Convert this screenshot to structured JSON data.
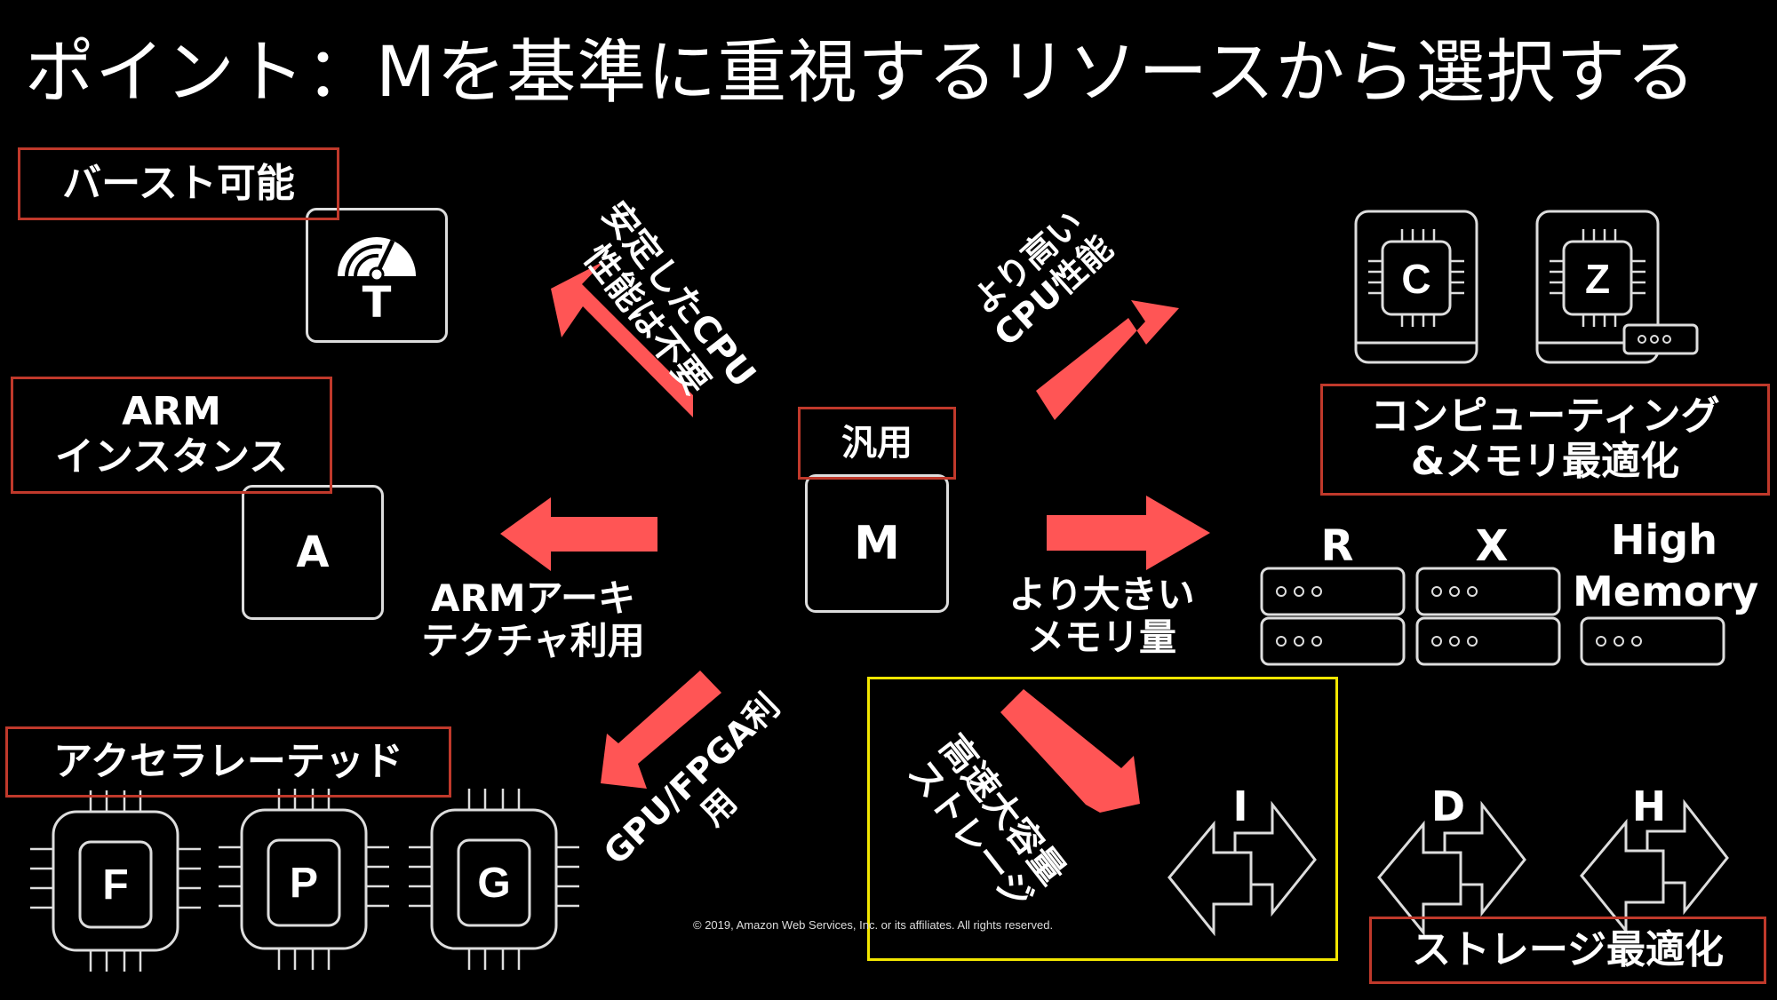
{
  "title": "ポイント：Mを基準に重視するリソースから選択する",
  "colors": {
    "background": "#000000",
    "arrow": "#ff5555",
    "label_border": "#c0392b",
    "highlight_border": "#f2e600",
    "icon_stroke": "#dddddd"
  },
  "center": {
    "label": "汎用",
    "instance": "M"
  },
  "groups": {
    "burst": {
      "label": "バースト可能",
      "instance": "T",
      "icon": "speedometer-icon"
    },
    "arm": {
      "label_line1": "ARM",
      "label_line2": "インスタンス",
      "instance": "A"
    },
    "accelerated": {
      "label": "アクセラレーテッド",
      "instances": [
        "F",
        "P",
        "G"
      ],
      "icon": "chip-icon"
    },
    "compute": {
      "instances": [
        "C",
        "Z"
      ],
      "icon": "chip-server-icon"
    },
    "memory": {
      "label_line1": "コンピューティング",
      "label_line2": "&メモリ最適化",
      "instances": [
        "R",
        "X"
      ],
      "high_memory_line1": "High",
      "high_memory_line2": "Memory",
      "icon": "server-rack-icon"
    },
    "storage": {
      "label": "ストレージ最適化",
      "instances": [
        "I",
        "D",
        "H"
      ],
      "icon": "transfer-arrows-icon"
    }
  },
  "arrows": {
    "up_left": {
      "line1": "安定したCPU",
      "line2": "性能は不要"
    },
    "up_right": {
      "line1": "より高い",
      "line2": "CPU性能"
    },
    "left": {
      "line1": "ARMアーキ",
      "line2": "テクチャ利用"
    },
    "right": {
      "line1": "より大きい",
      "line2": "メモリ量"
    },
    "down_left": {
      "line1": "GPU/FPGA利",
      "line2": "用"
    },
    "down_right": {
      "line1": "高速大容量",
      "line2": "ストレージ"
    }
  },
  "footer": {
    "copyright": "© 2019, Amazon Web Services, Inc. or its affiliates. All rights reserved."
  }
}
